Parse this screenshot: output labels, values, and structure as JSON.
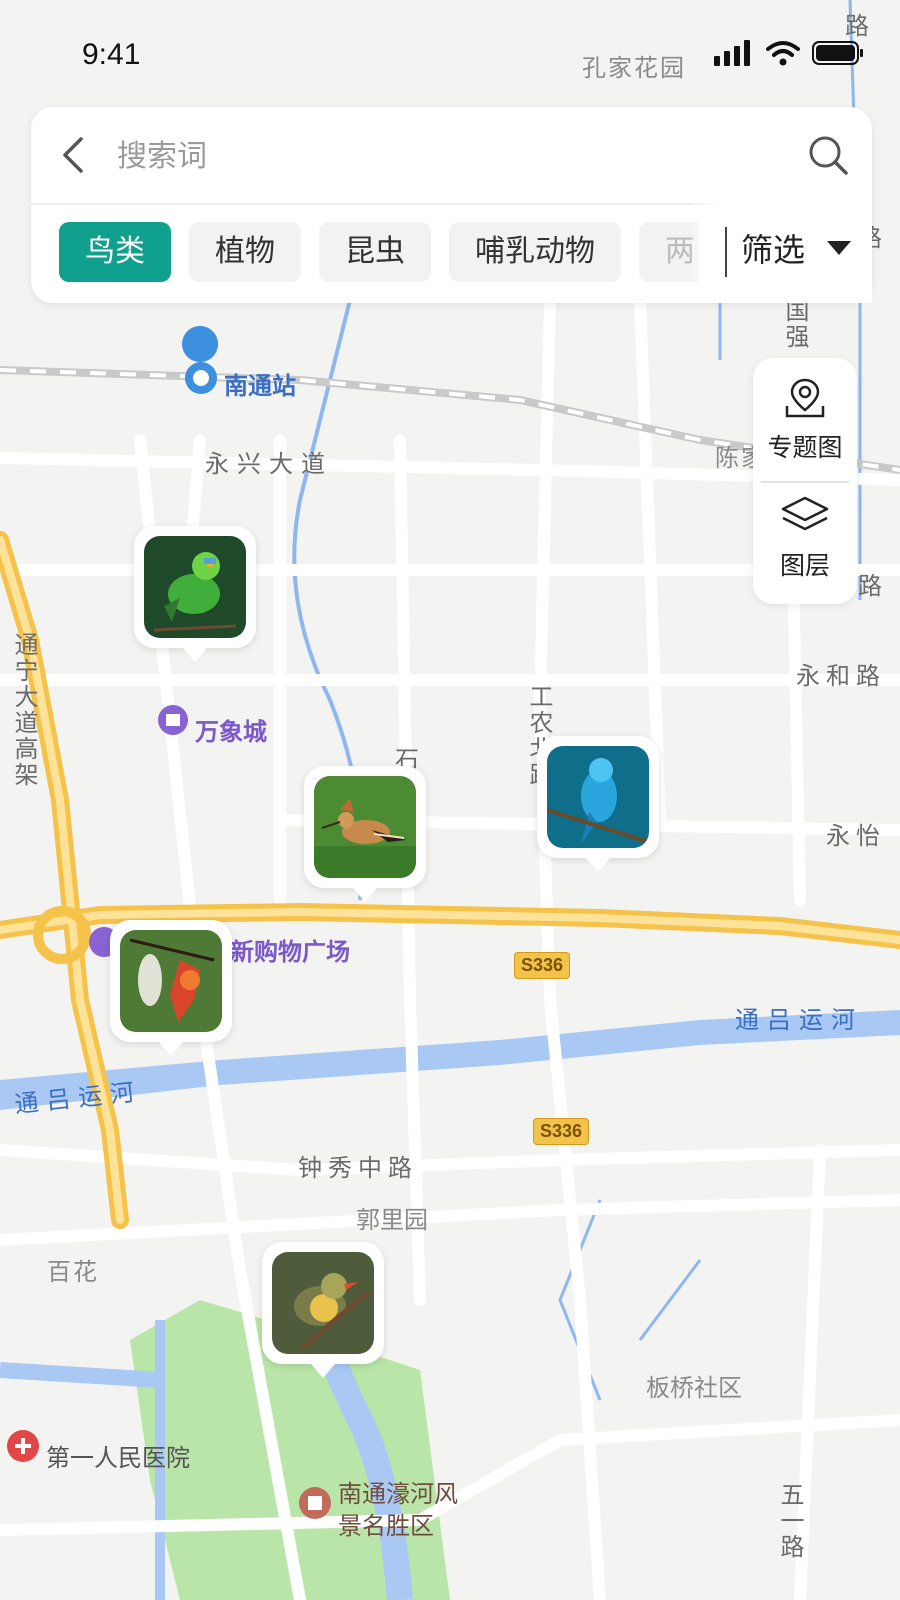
{
  "status_bar": {
    "time": "9:41"
  },
  "search": {
    "placeholder": "搜索词",
    "categories": [
      "鸟类",
      "植物",
      "昆虫",
      "哺乳动物",
      "两"
    ],
    "filter_label": "筛选"
  },
  "tools": {
    "topic_map": "专题图",
    "layers": "图层"
  },
  "map": {
    "labels": {
      "nantong_station": "南通站",
      "yongxing_avenue": "永兴大道",
      "wanxiang_city": "万象城",
      "tongning_viaduct": "通宁大道高架",
      "shi": "石",
      "gongnong_road": "工农北路",
      "yonghe_road": "永和路",
      "yongyi": "永怡",
      "shopping_plaza": "新购物广场",
      "tonglu_canal_east": "通吕运河",
      "tonglu_canal_west": "通吕运河",
      "zhongxiu_road": "钟秀中路",
      "guoliyuan": "郭里园",
      "baihua": "百花",
      "banqiao": "板桥社区",
      "hospital": "第一人民医院",
      "haohe_scenic": "南通濠河风景名胜区",
      "kongjia_garden": "孔家花园",
      "guoqiang": "国强",
      "chenjia": "陈家",
      "lu": "路",
      "wuyi": "五一路"
    },
    "road_badge_1": "S336",
    "road_badge_2": "S336"
  },
  "markers": [
    {
      "name": "green-barbet",
      "colors": [
        "#1f5a2a",
        "#3fae3b",
        "#6cd34a"
      ]
    },
    {
      "name": "hoopoe",
      "colors": [
        "#3d7a2d",
        "#c78a4a",
        "#5b3a24"
      ]
    },
    {
      "name": "blue-flycatcher",
      "colors": [
        "#0f6e8a",
        "#2aa6de",
        "#4ec4f2"
      ]
    },
    {
      "name": "sunbird",
      "colors": [
        "#436b2f",
        "#d8452a",
        "#f07a30"
      ]
    },
    {
      "name": "leiothrix",
      "colors": [
        "#4f5c3c",
        "#d6a12a",
        "#e9c24b"
      ]
    }
  ]
}
